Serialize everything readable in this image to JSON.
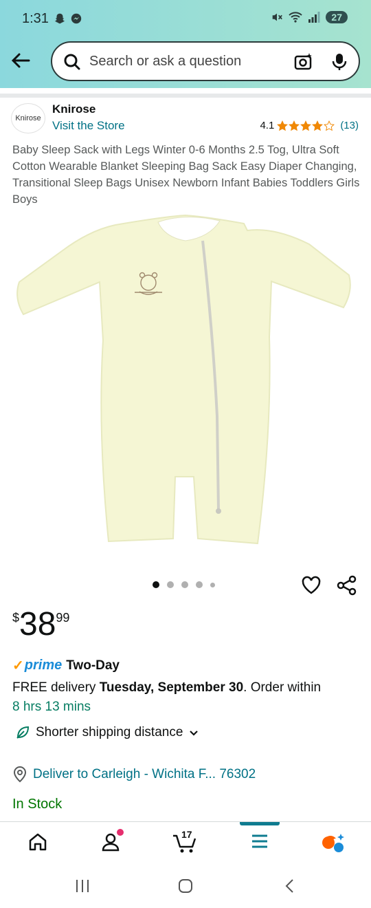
{
  "status_bar": {
    "time": "1:31",
    "battery": "27"
  },
  "search": {
    "placeholder": "Search or ask a question"
  },
  "brand": {
    "logo_text": "Knirose",
    "name": "Knirose",
    "visit_store": "Visit the Store"
  },
  "rating": {
    "score": "4.1",
    "stars": 4.1,
    "count": "(13)"
  },
  "product": {
    "title": "Baby Sleep Sack with Legs Winter 0-6 Months 2.5 Tog, Ultra Soft Cotton Wearable Blanket Sleeping Bag Sack Easy Diaper Changing, Transitional Sleep Bags Unisex Newborn Infant Babies Toddlers Girls Boys",
    "image_count": 5,
    "active_image": 1
  },
  "price": {
    "symbol": "$",
    "whole": "38",
    "fraction": "99"
  },
  "prime": {
    "check": "✓",
    "word": "prime",
    "speed": "Two-Day"
  },
  "delivery": {
    "prefix": "FREE delivery ",
    "date": "Tuesday, September 30",
    "suffix": ". Order within",
    "countdown": "8 hrs 13 mins"
  },
  "shipping_note": "Shorter shipping distance",
  "deliver_to": "Deliver to Carleigh - Wichita F... 76302",
  "stock": "In Stock",
  "bottom_nav": {
    "cart_count": "17"
  },
  "colors": {
    "link": "#007185",
    "prime_blue": "#1a8cd8",
    "stock_green": "#007600",
    "star": "#f08804"
  }
}
